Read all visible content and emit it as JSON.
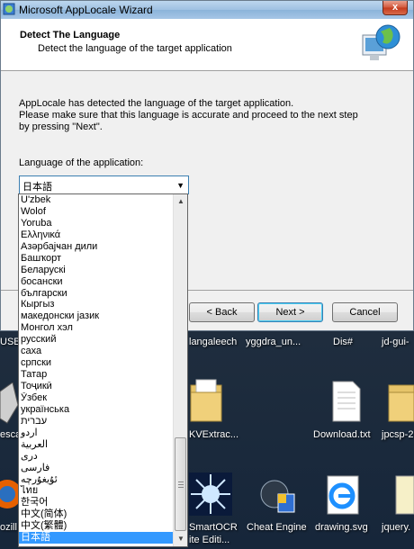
{
  "window": {
    "title": "Microsoft AppLocale Wizard",
    "close_label": "x"
  },
  "header": {
    "title": "Detect The Language",
    "subtitle": "Detect the language of the target application"
  },
  "body": {
    "line1": "AppLocale has detected the language of the target application.",
    "line2": "Please make sure that this  language is accurate and proceed to the next step",
    "line3": "by pressing \"Next\".",
    "language_label": "Language of the application:"
  },
  "combo": {
    "selected": "日本語"
  },
  "buttons": {
    "back": "< Back",
    "next": "Next >",
    "cancel": "Cancel"
  },
  "dropdown": {
    "items": [
      "U'zbek",
      "Wolof",
      "Yoruba",
      "Ελληνικά",
      "Азәрбајҹан дили",
      "Башҡорт",
      "Беларускі",
      "босански",
      "български",
      "Кыргыз",
      "македонски јазик",
      "Монгол хэл",
      "русский",
      "саха",
      "српски",
      "Татар",
      "Тоҷикӣ",
      "Ўзбек",
      "українська",
      "עברית",
      "اُردو",
      "العربية",
      "دری",
      "فارسی",
      "ئۇيغۇرچە",
      "ไทย",
      "한국어",
      "中文(简体)",
      "中文(繁體)",
      "日本語"
    ],
    "selected_index": 29
  },
  "desktop": {
    "row1_labels": [
      "USB ]",
      "langaleech",
      "yggdra_un...",
      "Dis#",
      "jd-gui-"
    ],
    "icons": [
      {
        "name": "escape",
        "label": "escap"
      },
      {
        "name": "kvextract",
        "label": "KVExtrac..."
      },
      {
        "name": "download-txt",
        "label": "Download.txt"
      },
      {
        "name": "jpcsp",
        "label": "jpcsp-2"
      },
      {
        "name": "firefox",
        "label": "ozill"
      },
      {
        "name": "smartocr",
        "label": "SmartOCR"
      },
      {
        "name": "smartocr-line2",
        "label": "ite Editi..."
      },
      {
        "name": "cheat-engine",
        "label": "Cheat Engine"
      },
      {
        "name": "drawing-svg",
        "label": "drawing.svg"
      },
      {
        "name": "jquery",
        "label": "jquery."
      }
    ]
  }
}
